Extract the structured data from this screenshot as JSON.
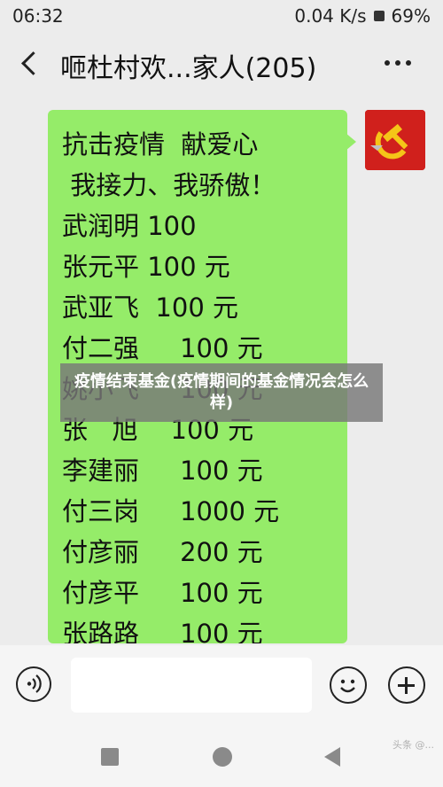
{
  "status_bar": {
    "time": "06:32",
    "network_speed": "0.04 K/s",
    "battery": "69%"
  },
  "header": {
    "title": "咂杜村欢...家人(205)"
  },
  "message": {
    "lines": [
      "抗击疫情  献爱心",
      " 我接力、我骄傲！",
      "武润明 100",
      "张元平 100 元",
      "武亚飞  100 元",
      "付二强     100 元",
      "姚小飞     100 元",
      "张   旭    100 元",
      "李建丽     100 元",
      "付三岗     1000 元",
      "付彦丽     200 元",
      "付彦平     100 元",
      "张路路     100 元"
    ]
  },
  "overlay": {
    "caption": "疫情结束基金(疫情期间的基金情况会怎么样)"
  },
  "watermark": "头条 @...",
  "colors": {
    "bubble": "#95ec69",
    "avatar": "#d0201c",
    "avatar_emblem": "#f5c518",
    "overlay": "#787878"
  },
  "icons": {
    "voice": "voice-icon",
    "emoji": "emoji-icon",
    "plus": "plus-icon",
    "back": "back-chevron-icon",
    "more": "more-dots-icon",
    "nav_recent": "nav-square-icon",
    "nav_home": "nav-circle-icon",
    "nav_back": "nav-triangle-icon"
  }
}
